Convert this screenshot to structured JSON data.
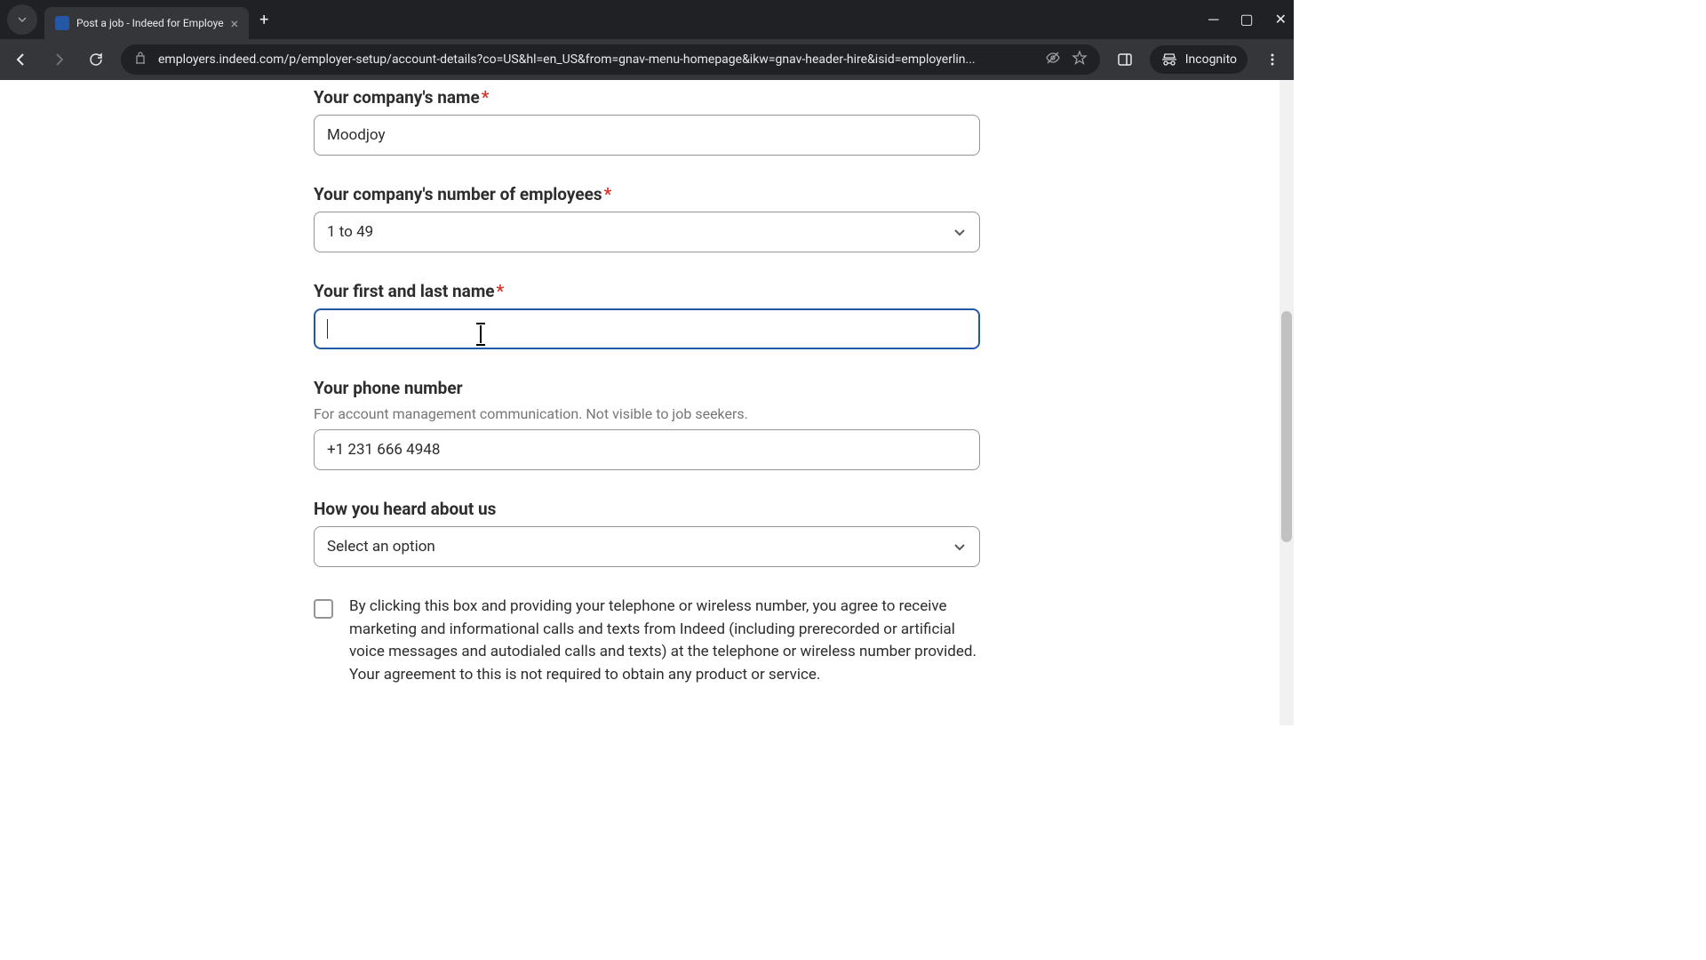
{
  "browser": {
    "tab_title": "Post a job - Indeed for Employe",
    "url": "employers.indeed.com/p/employer-setup/account-details?co=US&hl=en_US&from=gnav-menu-homepage&ikw=gnav-header-hire&isid=employerlin...",
    "incognito_label": "Incognito"
  },
  "form": {
    "company_name": {
      "label": "Your company's name",
      "value": "Moodjoy"
    },
    "employees": {
      "label": "Your company's number of employees",
      "value": "1 to 49"
    },
    "name": {
      "label": "Your first and last name",
      "value": ""
    },
    "phone": {
      "label": "Your phone number",
      "helper": "For account management communication. Not visible to job seekers.",
      "value": "+1 231 666 4948"
    },
    "heard_about": {
      "label": "How you heard about us",
      "value": "Select an option"
    },
    "consent": {
      "text": "By clicking this box and providing your telephone or wireless number, you agree to receive marketing and informational calls and texts from Indeed (including prerecorded or artificial voice messages and autodialed calls and texts) at the telephone or wireless number provided. Your agreement to this is not required to obtain any product or service."
    }
  }
}
